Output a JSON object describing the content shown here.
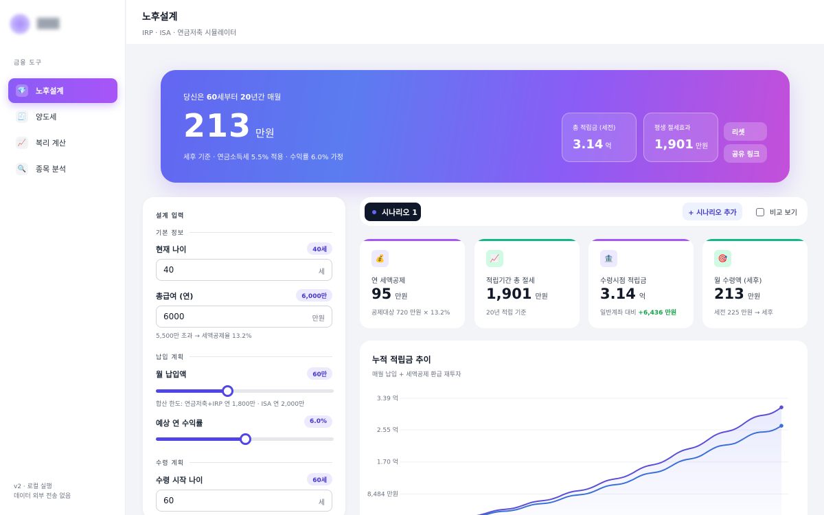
{
  "sidebar": {
    "section_label": "금융 도구",
    "items": [
      {
        "label": "노후설계",
        "icon": "diamond-icon",
        "glyph": "💎"
      },
      {
        "label": "양도세",
        "icon": "receipt-icon",
        "glyph": "🧾"
      },
      {
        "label": "복리 계산",
        "icon": "chart-up-icon",
        "glyph": "📈"
      },
      {
        "label": "종목 분석",
        "icon": "magnifier-icon",
        "glyph": "🔍"
      }
    ],
    "footer_line1": "v2 · 로컬 실행",
    "footer_line2": "데이터 외부 전송 없음"
  },
  "header": {
    "title": "노후설계",
    "subtitle": "IRP · ISA · 연금저축 시뮬레이터"
  },
  "hero": {
    "lead_prefix": "당신은 ",
    "lead_age": "60",
    "lead_mid": "세부터 ",
    "lead_years": "20",
    "lead_suffix": "년간 매월",
    "amount": "213",
    "amount_unit": "만원",
    "note": "세후 기준 · 연금소득세 5.5% 적용 · 수익률 6.0% 가정",
    "stats": [
      {
        "label": "총 적립금 (세전)",
        "value": "3.14",
        "unit": "억"
      },
      {
        "label": "평생 절세효과",
        "value": "1,901",
        "unit": "만원"
      }
    ],
    "reset_label": "리셋",
    "share_label": "공유 링크"
  },
  "inputs": {
    "panel_title": "설계 입력",
    "basic_label": "기본 정보",
    "age_label": "현재 나이",
    "age_badge": "40세",
    "age_value": "40",
    "age_unit": "세",
    "salary_label": "총급여 (연)",
    "salary_badge": "6,000만",
    "salary_value": "6000",
    "salary_unit": "만원",
    "salary_hint": "5,500만 초과 → 세액공제율 13.2%",
    "contrib_group": "납입 계획",
    "monthly_label": "월 납입액",
    "monthly_badge": "60만",
    "monthly_fraction": 0.4,
    "monthly_hint": "합산 한도: 연금저축+IRP 연 1,800만 · ISA 연 2,000만",
    "return_label": "예상 연 수익률",
    "return_badge": "6.0%",
    "return_fraction": 0.5,
    "receive_group": "수령 계획",
    "start_label": "수령 시작 나이",
    "start_badge": "60세",
    "start_value": "60",
    "start_unit": "세"
  },
  "scenario": {
    "chip_label": "시나리오 1",
    "add_label": "+ 시나리오 추가",
    "compare_label": "비교 보기"
  },
  "metrics": [
    {
      "icon": "money-bag-icon",
      "glyph": "💰",
      "label": "연 세액공제",
      "value": "95",
      "unit": "만원",
      "sub": "공제대상 720 만원 × 13.2%",
      "sub_highlight": "",
      "accent": "#a855f7",
      "icon_bg": "#ede9fe"
    },
    {
      "icon": "chart-up-icon",
      "glyph": "📈",
      "label": "적립기간 총 절세",
      "value": "1,901",
      "unit": "만원",
      "sub": "20년 적립 기준",
      "sub_highlight": "",
      "accent": "#10b981",
      "icon_bg": "#d1fae5"
    },
    {
      "icon": "bank-icon",
      "glyph": "🏦",
      "label": "수령시점 적립금",
      "value": "3.14",
      "unit": "억",
      "sub": "일반계좌 대비 ",
      "sub_highlight": "+6,436 만원",
      "accent": "#a855f7",
      "icon_bg": "#ede9fe"
    },
    {
      "icon": "target-icon",
      "glyph": "🎯",
      "label": "월 수령액 (세후)",
      "value": "213",
      "unit": "만원",
      "sub": "세전 225 만원 → 세후",
      "sub_highlight": "",
      "accent": "#10b981",
      "icon_bg": "#d1fae5"
    }
  ],
  "chart": {
    "title": "누적 적립금 추이",
    "subtitle": "매월 납입 + 세액공제 환급 재투자"
  },
  "chart_data": {
    "type": "area",
    "title": "누적 적립금 추이",
    "y_tick_labels": [
      "3.39 억",
      "2.55 억",
      "1.70 억",
      "8,484 만원"
    ],
    "y_tick_values": [
      33900,
      25500,
      17000,
      8484
    ],
    "ylim": [
      0,
      33900
    ],
    "grid": true,
    "series": [
      {
        "name": "",
        "color": "#5b4fd6",
        "x": [
          0,
          2,
          4,
          6,
          8,
          10,
          12,
          14,
          16,
          18,
          20
        ],
        "values": [
          0,
          1550,
          3350,
          5450,
          7900,
          10800,
          14200,
          18200,
          22800,
          27300,
          31500
        ]
      },
      {
        "name": "",
        "color": "#3b6fd8",
        "x": [
          0,
          2,
          4,
          6,
          8,
          10,
          12,
          14,
          16,
          18,
          20
        ],
        "values": [
          0,
          1400,
          3000,
          4850,
          7000,
          9500,
          12400,
          15800,
          19700,
          23300,
          26600
        ]
      }
    ]
  }
}
